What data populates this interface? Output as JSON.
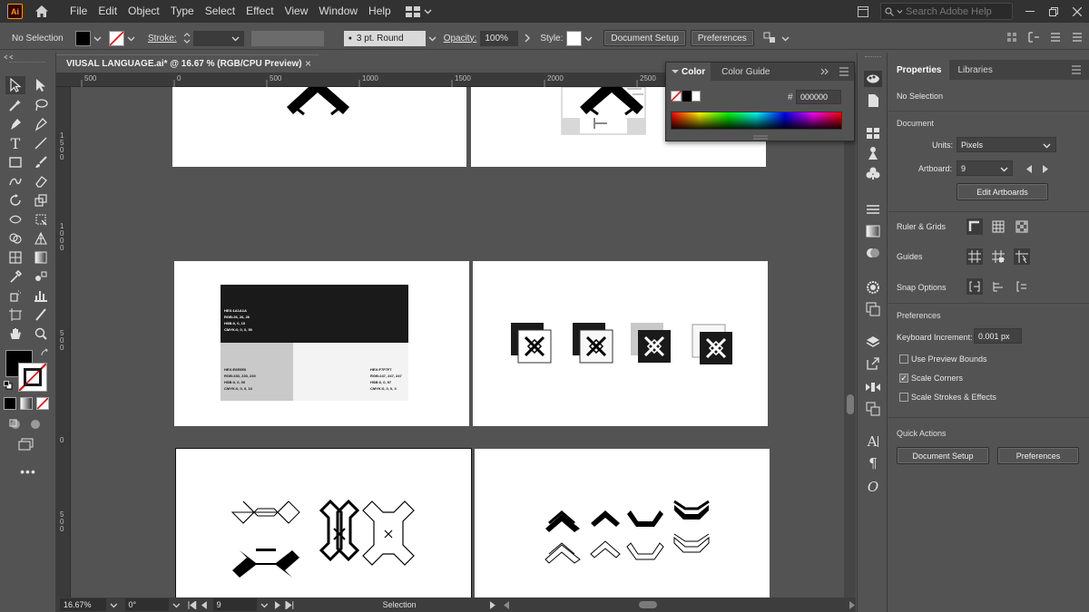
{
  "app": {
    "logo": "Ai"
  },
  "menu": [
    "File",
    "Edit",
    "Object",
    "Type",
    "Select",
    "Effect",
    "View",
    "Window",
    "Help"
  ],
  "search": {
    "placeholder": "Search Adobe Help"
  },
  "control": {
    "selection": "No Selection",
    "stroke_label": "Stroke:",
    "brush_value": "3 pt. Round",
    "opacity_label": "Opacity:",
    "opacity_value": "100%",
    "style_label": "Style:",
    "document_setup": "Document Setup",
    "preferences": "Preferences"
  },
  "document": {
    "tab_title": "VIUSAL LANGUAGE.ai* @ 16.67 % (RGB/CPU Preview)",
    "close": "×"
  },
  "ruler": {
    "top": [
      "500",
      "0",
      "500",
      "1000",
      "1500",
      "2000",
      "2500"
    ],
    "left": [
      "1500",
      "1000",
      "500",
      "0",
      "500"
    ]
  },
  "swatches": [
    {
      "hex": "HEX:1A1A1A",
      "rgb": "RGB:26, 26, 26",
      "hsb": "HSB:0, 0, 10",
      "cmyk": "CMYK:0, 0, 0, 90",
      "color": "#1a1a1a"
    },
    {
      "hex": "HEX:E6E6E6",
      "rgb": "RGB:230, 230, 230",
      "hsb": "HSB:0, 0, 90",
      "cmyk": "CMYK:0, 0, 0, 10",
      "color": "#c9c9c9"
    },
    {
      "hex": "HEX:F7F7F7",
      "rgb": "RGB:247, 247, 247",
      "hsb": "HSB:0, 0, 97",
      "cmyk": "CMYK:0, 0, 0, 3",
      "color": "#f3f3f3"
    }
  ],
  "status": {
    "zoom": "16.67%",
    "rotation": "0°",
    "artboard": "9",
    "tool": "Selection"
  },
  "color_panel": {
    "tabs": [
      "Color",
      "Color Guide"
    ],
    "hex_label": "#",
    "hex_value": "000000"
  },
  "properties": {
    "tabs": [
      "Properties",
      "Libraries"
    ],
    "selection": "No Selection",
    "document_heading": "Document",
    "units_label": "Units:",
    "units_value": "Pixels",
    "artboard_label": "Artboard:",
    "artboard_value": "9",
    "edit_artboards": "Edit Artboards",
    "ruler_grids": "Ruler & Grids",
    "guides": "Guides",
    "snap_options": "Snap Options",
    "preferences_heading": "Preferences",
    "keyboard_increment_label": "Keyboard Increment:",
    "keyboard_increment_value": "0.001 px",
    "use_preview_bounds": "Use Preview Bounds",
    "scale_corners": "Scale Corners",
    "scale_strokes": "Scale Strokes & Effects",
    "use_preview_bounds_checked": false,
    "scale_corners_checked": true,
    "scale_strokes_checked": false,
    "quick_actions": "Quick Actions",
    "document_setup": "Document Setup",
    "preferences": "Preferences"
  }
}
